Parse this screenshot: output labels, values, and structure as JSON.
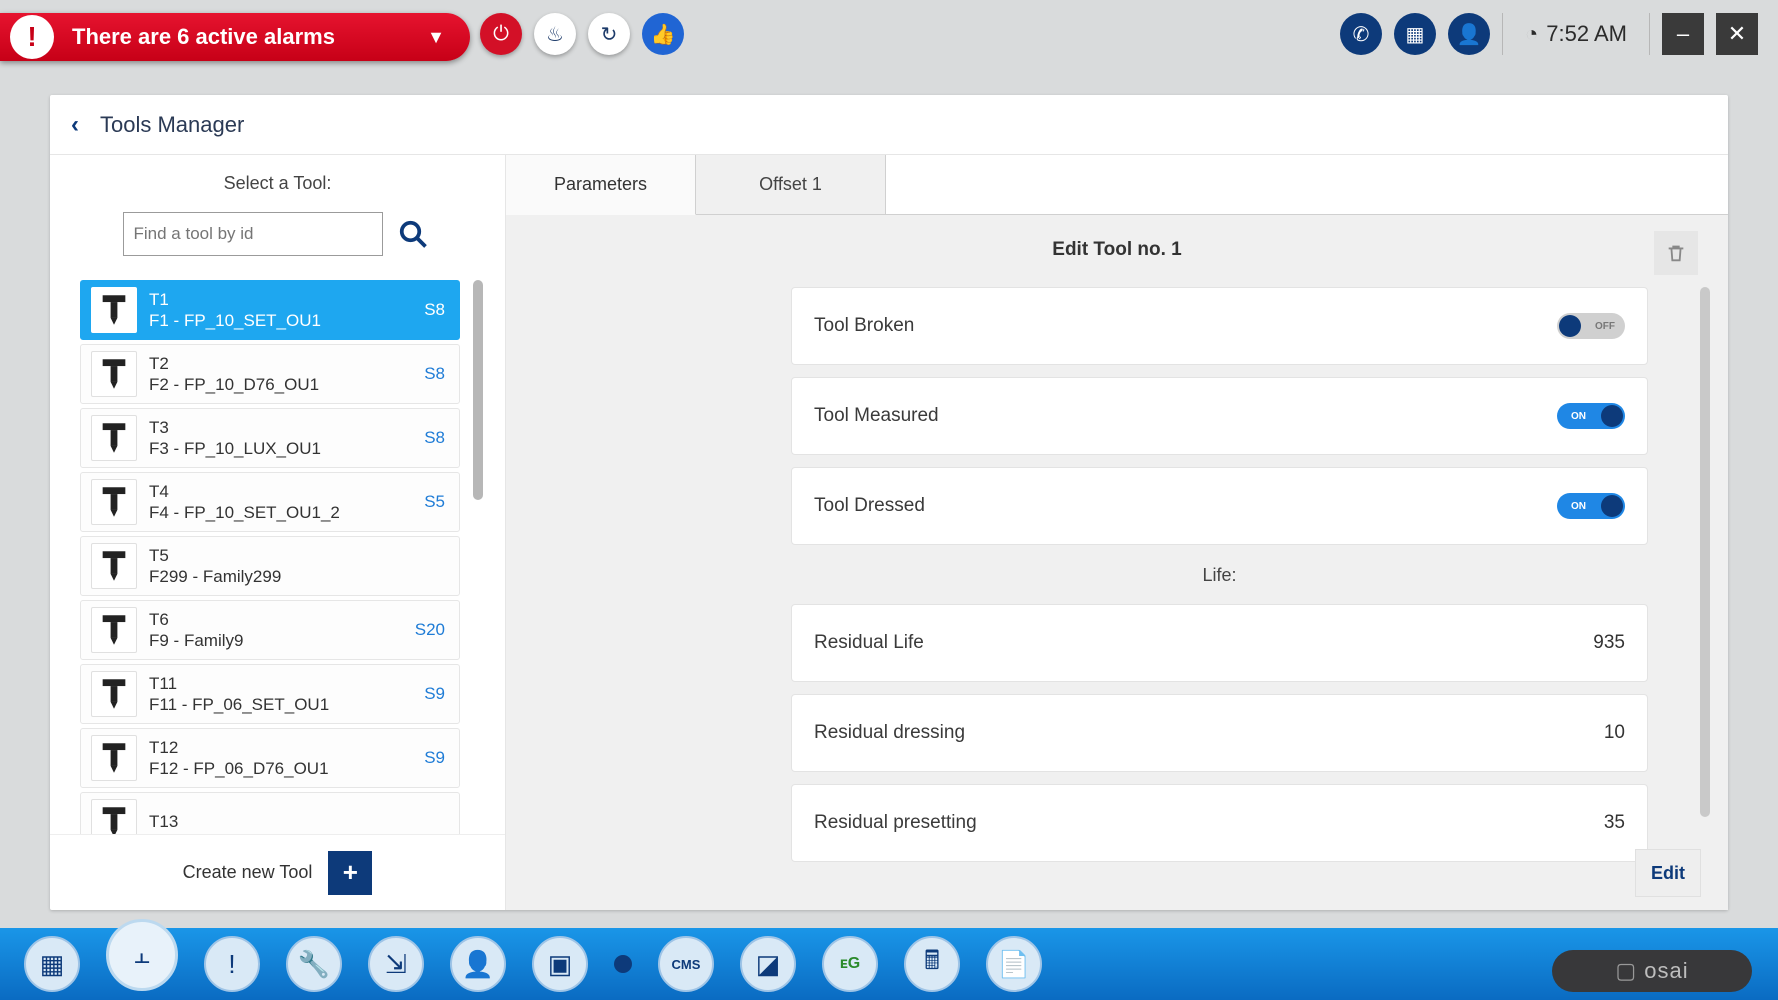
{
  "header": {
    "alarm_text": "There are 6 active alarms",
    "clock": "7:52 AM"
  },
  "page": {
    "title": "Tools Manager",
    "select_label": "Select a Tool:",
    "search_placeholder": "Find a tool by id",
    "create_label": "Create new Tool",
    "tabs": {
      "parameters": "Parameters",
      "offset": "Offset 1"
    },
    "edit_title": "Edit Tool no. 1",
    "edit_button": "Edit",
    "life_label": "Life:"
  },
  "tools": [
    {
      "id": "T1",
      "family": "F1 - FP_10_SET_OU1",
      "slot": "S8",
      "selected": true
    },
    {
      "id": "T2",
      "family": "F2 - FP_10_D76_OU1",
      "slot": "S8"
    },
    {
      "id": "T3",
      "family": "F3 - FP_10_LUX_OU1",
      "slot": "S8"
    },
    {
      "id": "T4",
      "family": "F4 - FP_10_SET_OU1_2",
      "slot": "S5"
    },
    {
      "id": "T5",
      "family": "F299 - Family299",
      "slot": ""
    },
    {
      "id": "T6",
      "family": "F9 - Family9",
      "slot": "S20"
    },
    {
      "id": "T11",
      "family": "F11 - FP_06_SET_OU1",
      "slot": "S9"
    },
    {
      "id": "T12",
      "family": "F12 - FP_06_D76_OU1",
      "slot": "S9"
    },
    {
      "id": "T13",
      "family": "",
      "slot": ""
    }
  ],
  "params": {
    "toggle_rows": [
      {
        "label": "Tool Broken",
        "state": "off",
        "txt": "OFF"
      },
      {
        "label": "Tool Measured",
        "state": "on",
        "txt": "ON"
      },
      {
        "label": "Tool Dressed",
        "state": "on",
        "txt": "ON"
      }
    ],
    "value_rows": [
      {
        "label": "Residual Life",
        "value": "935"
      },
      {
        "label": "Residual dressing",
        "value": "10"
      },
      {
        "label": "Residual presetting",
        "value": "35"
      }
    ]
  },
  "brand": {
    "name": "osai"
  }
}
